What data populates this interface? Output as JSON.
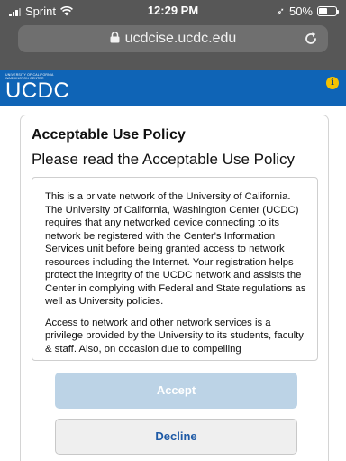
{
  "status_bar": {
    "carrier": "Sprint",
    "time": "12:29 PM",
    "battery_percent": "50%",
    "battery_level": 0.5,
    "icons": [
      "signal-icon",
      "wifi-icon",
      "location-arrow-icon",
      "battery-icon"
    ]
  },
  "url_bar": {
    "url": "ucdcise.ucdc.edu",
    "icons": [
      "lock-icon",
      "reload-icon"
    ]
  },
  "site_header": {
    "logo_small_line1": "University of California",
    "logo_small_line2": "Washington Center",
    "logo_text": "UCDC",
    "info_glyph": "i",
    "colors": {
      "header_bg": "#0f64b6",
      "info_bg": "#f5c200"
    }
  },
  "policy": {
    "title": "Acceptable Use Policy",
    "subtitle": "Please read the Acceptable Use Policy",
    "paragraphs": [
      "This is a private network of the University of California. The University of California, Washington Center (UCDC) requires that any networked device connecting to its network be registered with the Center's Information Services unit before being granted access to network resources including the Internet. Your registration helps protect the integrity of the UCDC network and assists the Center in complying with Federal and State regulations as well as University policies.",
      "Access to network and other network services is a privilege provided by the University to its students, faculty & staff. Also, on occasion due to compelling"
    ]
  },
  "buttons": {
    "accept_label": "Accept",
    "decline_label": "Decline",
    "colors": {
      "accept_bg": "#bcd3e6",
      "decline_text": "#1e5aa6"
    }
  }
}
